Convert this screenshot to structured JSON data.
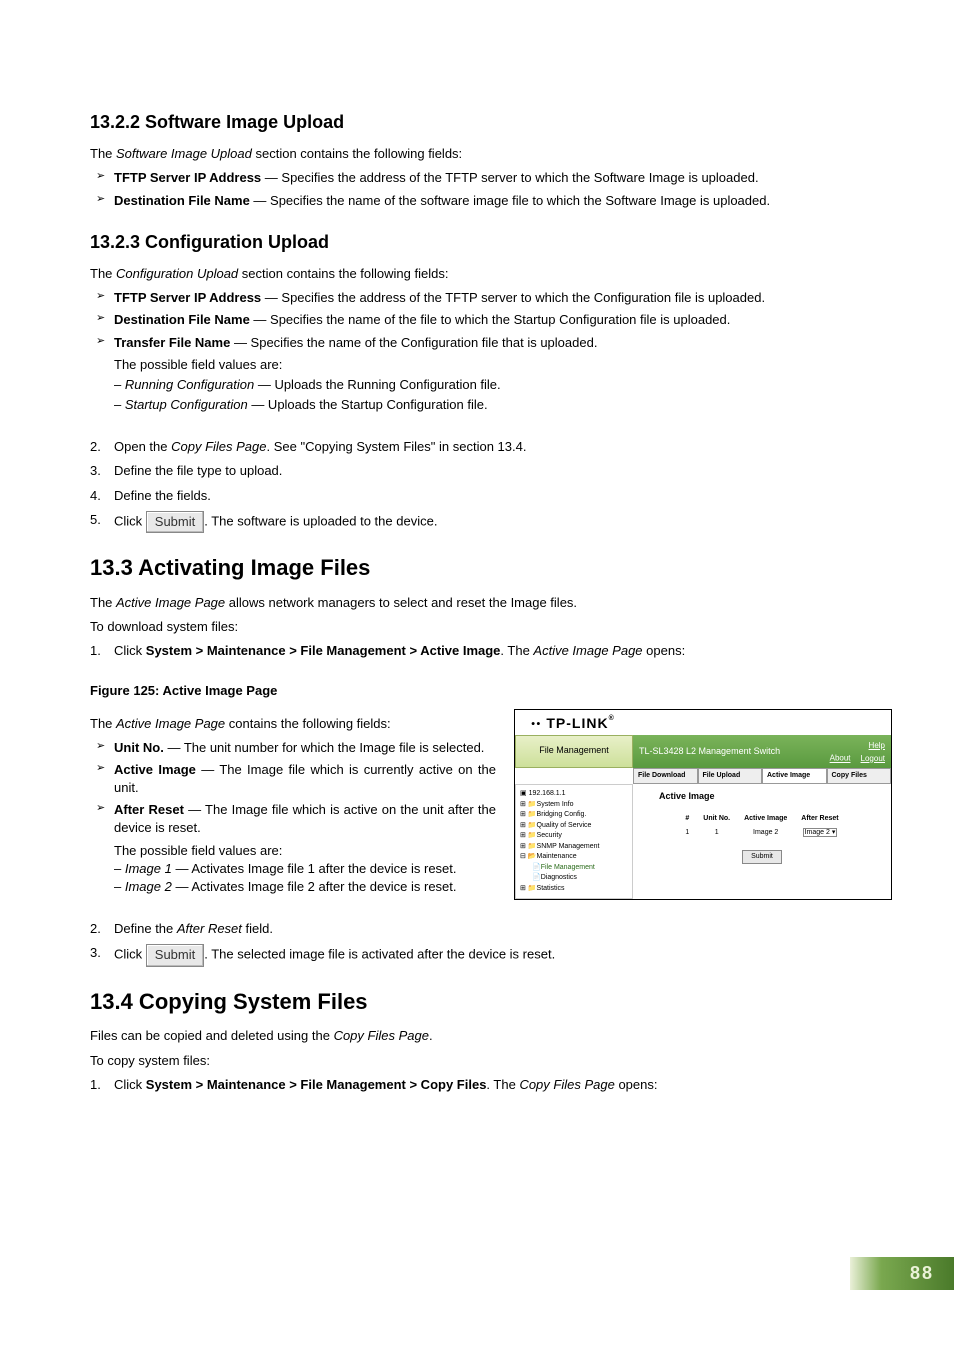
{
  "s1322": {
    "heading": "13.2.2  Software Image Upload",
    "intro_pre": "The ",
    "intro_em": "Software Image Upload",
    "intro_post": " section contains the following fields:",
    "b1_strong": "TFTP Server IP Address",
    "b1_rest": " — Specifies the address of the TFTP server to which the Software Image is uploaded.",
    "b2_strong": "Destination File Name",
    "b2_rest": " — Specifies the name of the software image file to which the Software Image is uploaded."
  },
  "s1323": {
    "heading": "13.2.3  Configuration Upload",
    "intro_pre": "The ",
    "intro_em": "Configuration Upload",
    "intro_post": " section contains the following fields:",
    "b1_strong": "TFTP Server IP Address",
    "b1_rest": " — Specifies the address of the TFTP server to which the Configuration file is uploaded.",
    "b2_strong": "Destination File Name",
    "b2_rest": " — Specifies the name of the file to which the Startup Configuration file is uploaded.",
    "b3_strong": "Transfer File Name",
    "b3_rest": " — Specifies the name of the Configuration file that is uploaded.",
    "possible": "The possible field values are:",
    "opt1_em": "Running Configuration",
    "opt1_rest": " — Uploads the Running Configuration file.",
    "opt2_em": "Startup Configuration",
    "opt2_rest": " — Uploads the Startup Configuration file."
  },
  "steps_a": {
    "s2_pre": "Open the ",
    "s2_em": "Copy Files Page",
    "s2_post": ". See \"Copying System Files\" in section 13.4.",
    "s3": "Define the file type to upload.",
    "s4": "Define the fields.",
    "s5_pre": "Click ",
    "s5_btn": "Submit",
    "s5_post": ". The software is uploaded to the device."
  },
  "s133": {
    "heading": "13.3  Activating Image Files",
    "intro_pre": "The ",
    "intro_em": "Active Image Page",
    "intro_post": " allows network managers to select and reset the Image files.",
    "to": "To download system files:",
    "step1_pre": "Click ",
    "step1_strong": "System > Maintenance > File Management > Active Image",
    "step1_mid": ". The ",
    "step1_em": "Active Image Page",
    "step1_post": " opens:",
    "fig": "Figure 125: Active Image Page",
    "fields_pre": "The ",
    "fields_em": "Active Image Page",
    "fields_post": " contains the following fields:",
    "f1_strong": "Unit No.",
    "f1_rest": " — The unit number for which the Image file is selected.",
    "f2_strong": "Active Image",
    "f2_rest": " — The Image file which is currently active on the unit.",
    "f3_strong": "After Reset",
    "f3_rest": " — The Image file which is active on the unit after the device is reset.",
    "possible": "The possible field values are:",
    "opt1_em": "Image 1",
    "opt1_rest": " — Activates Image file 1 after the device is reset.",
    "opt2_em": "Image 2",
    "opt2_rest": " — Activates Image file 2 after the device is reset.",
    "step2_pre": "Define the ",
    "step2_em": "After Reset",
    "step2_post": " field.",
    "step3_pre": "Click ",
    "step3_btn": "Submit",
    "step3_post": ". The selected image file is activated after the device is reset."
  },
  "s134": {
    "heading": "13.4  Copying System Files",
    "intro_pre": "Files can be copied and deleted using the ",
    "intro_em": "Copy Files Page",
    "intro_post": ".",
    "to": "To copy system files:",
    "step1_pre": "Click ",
    "step1_strong": "System > Maintenance > File Management > Copy Files",
    "step1_mid": ". The ",
    "step1_em": "Copy Files Page",
    "step1_post": " opens:"
  },
  "screenshot": {
    "logo": "TP-LINK",
    "left_head": "File Management",
    "title_line": "TL-SL3428 L2 Management Switch",
    "about": "About",
    "help": "Help",
    "logout": "Logout",
    "tabs": [
      "File Download",
      "File Upload",
      "Active Image",
      "Copy Files"
    ],
    "tree": [
      "192.168.1.1",
      "System Info",
      "Bridging Config.",
      "Quality of Service",
      "Security",
      "SNMP Management",
      "Maintenance",
      "File Management",
      "Diagnostics",
      "Statistics"
    ],
    "main_title": "Active Image",
    "th": [
      "#",
      "Unit No.",
      "Active Image",
      "After Reset"
    ],
    "row": [
      "1",
      "1",
      "Image 2",
      "Image 2"
    ],
    "submit": "Submit"
  },
  "pagenum": "88"
}
